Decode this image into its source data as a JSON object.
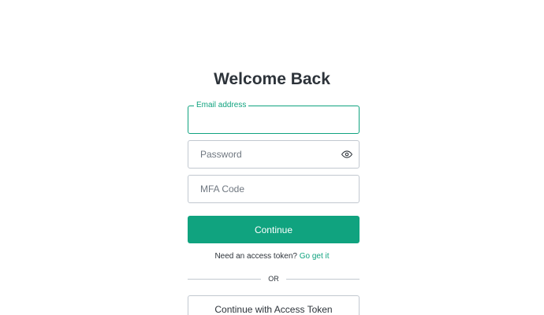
{
  "title": "Welcome Back",
  "email": {
    "label": "Email address",
    "value": ""
  },
  "password": {
    "placeholder": "Password",
    "toggle_icon": "eye-icon"
  },
  "mfa": {
    "placeholder": "MFA Code"
  },
  "continue_label": "Continue",
  "token_prompt": {
    "text": "Need an access token?",
    "link": "Go get it"
  },
  "divider_text": "OR",
  "access_token_label": "Continue with Access Token",
  "colors": {
    "accent": "#10a37f",
    "border": "#c2c8d0",
    "text": "#2d333a"
  }
}
